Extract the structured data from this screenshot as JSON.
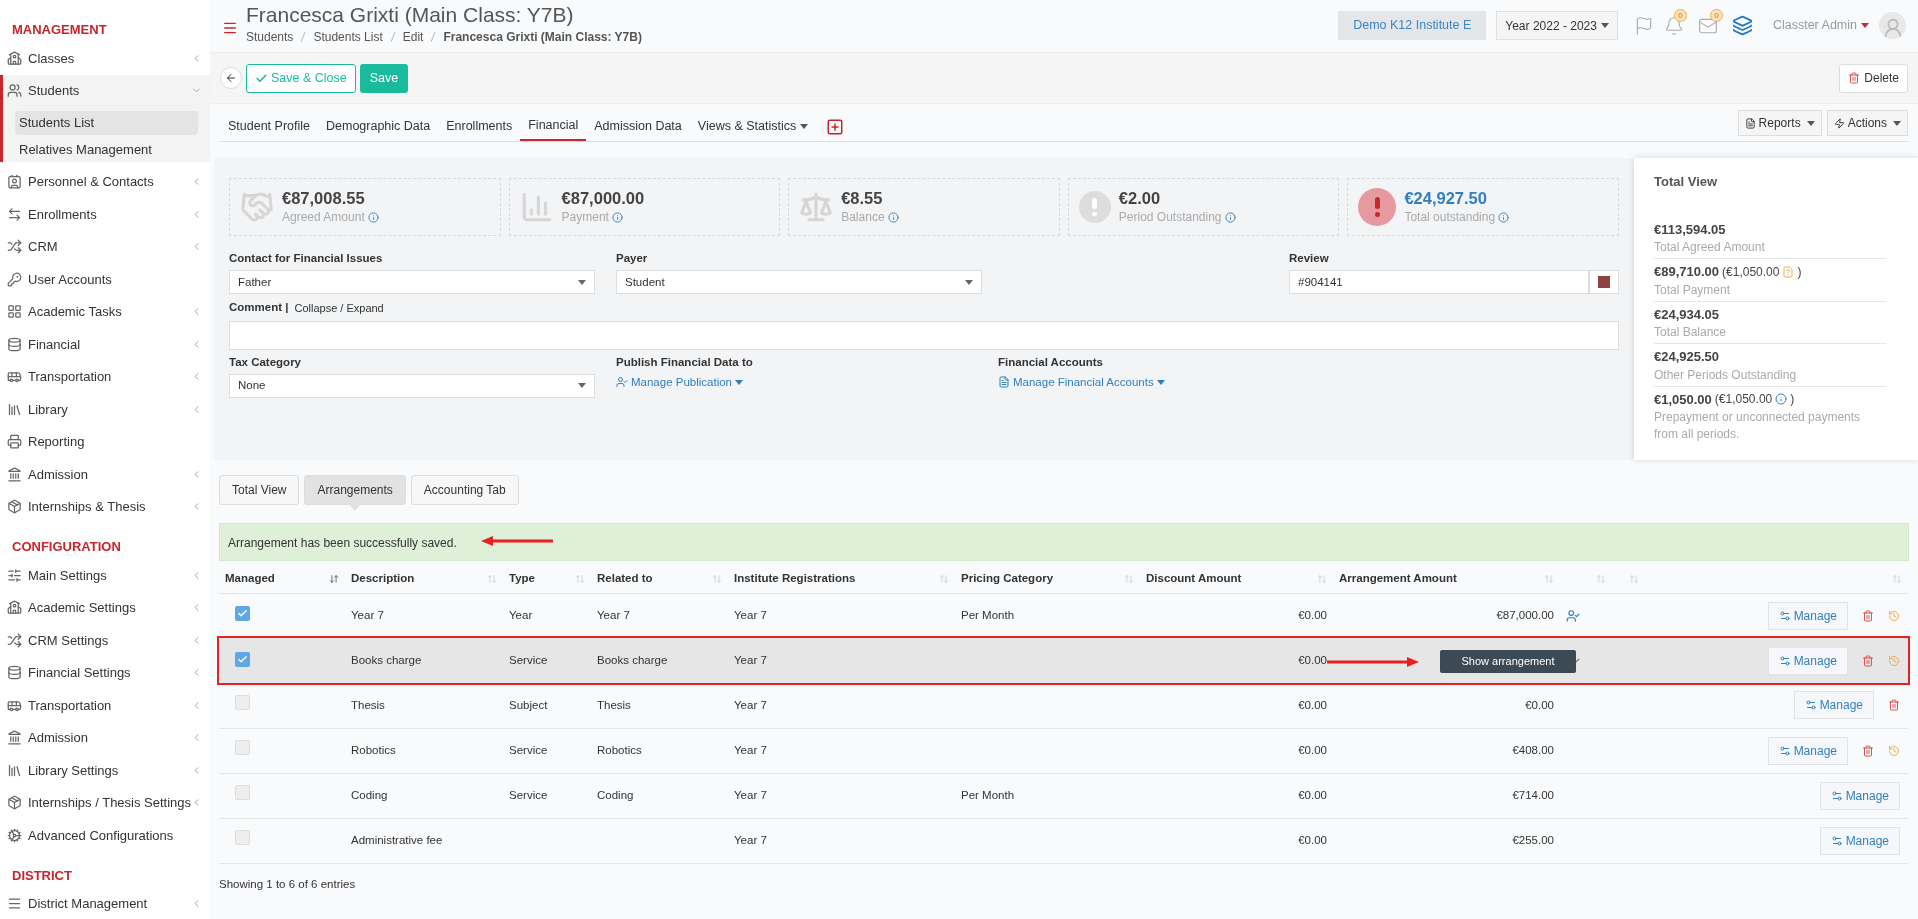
{
  "sidebar": {
    "sections": [
      {
        "title": "MANAGEMENT",
        "items": [
          {
            "label": "Classes",
            "submenu": true,
            "expanded": false,
            "selected": false
          },
          {
            "label": "Students",
            "submenu": true,
            "expanded": true,
            "selected": false,
            "children": [
              {
                "label": "Students List",
                "selected": true
              },
              {
                "label": "Relatives Management",
                "selected": false
              }
            ]
          },
          {
            "label": "Personnel & Contacts",
            "submenu": true,
            "expanded": false,
            "selected": false
          },
          {
            "label": "Enrollments",
            "submenu": true,
            "expanded": false,
            "selected": false
          },
          {
            "label": "CRM",
            "submenu": true,
            "expanded": false,
            "selected": false
          },
          {
            "label": "User Accounts",
            "submenu": false,
            "expanded": false,
            "selected": false
          },
          {
            "label": "Academic Tasks",
            "submenu": true,
            "expanded": false,
            "selected": false
          },
          {
            "label": "Financial",
            "submenu": true,
            "expanded": false,
            "selected": false
          },
          {
            "label": "Transportation",
            "submenu": true,
            "expanded": false,
            "selected": false
          },
          {
            "label": "Library",
            "submenu": true,
            "expanded": false,
            "selected": false
          },
          {
            "label": "Reporting",
            "submenu": false,
            "expanded": false,
            "selected": false
          },
          {
            "label": "Admission",
            "submenu": true,
            "expanded": false,
            "selected": false
          },
          {
            "label": "Internships & Thesis",
            "submenu": true,
            "expanded": false,
            "selected": false
          }
        ]
      },
      {
        "title": "CONFIGURATION",
        "items": [
          {
            "label": "Main Settings",
            "submenu": true,
            "expanded": false,
            "selected": false
          },
          {
            "label": "Academic Settings",
            "submenu": true,
            "expanded": false,
            "selected": false
          },
          {
            "label": "CRM Settings",
            "submenu": true,
            "expanded": false,
            "selected": false
          },
          {
            "label": "Financial Settings",
            "submenu": true,
            "expanded": false,
            "selected": false
          },
          {
            "label": "Transportation",
            "submenu": true,
            "expanded": false,
            "selected": false
          },
          {
            "label": "Admission",
            "submenu": true,
            "expanded": false,
            "selected": false
          },
          {
            "label": "Library Settings",
            "submenu": true,
            "expanded": false,
            "selected": false
          },
          {
            "label": "Internships / Thesis Settings",
            "submenu": true,
            "expanded": false,
            "selected": false
          },
          {
            "label": "Advanced Configurations",
            "submenu": false,
            "expanded": false,
            "selected": false
          }
        ]
      },
      {
        "title": "DISTRICT",
        "items": [
          {
            "label": "District Management",
            "submenu": true,
            "expanded": false,
            "selected": false
          }
        ]
      }
    ]
  },
  "header": {
    "title": "Francesca Grixti (Main Class: Y7B)",
    "breadcrumb": [
      "Students",
      "Students List",
      "Edit",
      "Francesca Grixti (Main Class: Y7B)"
    ],
    "institute": "Demo K12 Institute E",
    "year": "Year 2022 - 2023",
    "notifications": "0",
    "messages": "0",
    "user": "Classter Admin"
  },
  "toolbar": {
    "save_close": "Save & Close",
    "save": "Save",
    "delete": "Delete"
  },
  "tabs": [
    {
      "label": "Student Profile",
      "selected": false,
      "dropdown": false
    },
    {
      "label": "Demographic Data",
      "selected": false,
      "dropdown": false
    },
    {
      "label": "Enrollments",
      "selected": false,
      "dropdown": false
    },
    {
      "label": "Financial",
      "selected": true,
      "dropdown": false
    },
    {
      "label": "Admission Data",
      "selected": false,
      "dropdown": false
    },
    {
      "label": "Views & Statistics",
      "selected": false,
      "dropdown": true
    }
  ],
  "tab_buttons": [
    "Reports",
    "Actions"
  ],
  "stats": [
    {
      "value": "€87,008.55",
      "label": "Agreed Amount",
      "alert": false
    },
    {
      "value": "€87,000.00",
      "label": "Payment",
      "alert": false
    },
    {
      "value": "€8.55",
      "label": "Balance",
      "alert": false
    },
    {
      "value": "€2.00",
      "label": "Period Outstanding",
      "alert": false
    },
    {
      "value": "€24,927.50",
      "label": "Total outstanding",
      "alert": true
    }
  ],
  "form": {
    "contact": {
      "label": "Contact for Financial Issues",
      "value": "Father"
    },
    "payer": {
      "label": "Payer",
      "value": "Student"
    },
    "review": {
      "label": "Review",
      "value": "#904141",
      "color": "#904141"
    },
    "comment": {
      "label": "Comment |",
      "toggle": "Collapse / Expand"
    },
    "tax": {
      "label": "Tax Category",
      "value": "None"
    },
    "publish": {
      "label": "Publish Financial Data to",
      "link": "Manage Publication"
    },
    "accounts": {
      "label": "Financial Accounts",
      "link": "Manage Financial Accounts"
    }
  },
  "total_view": {
    "title": "Total View",
    "items": [
      {
        "kind": "plain",
        "value": "€113,594.05",
        "label": "Total Agreed Amount"
      },
      {
        "kind": "file",
        "value": "€89,710.00",
        "extra": "(€1,050.00",
        "extra_end": ")",
        "label": "Total Payment"
      },
      {
        "kind": "plain",
        "value": "€24,934.05",
        "label": "Total Balance"
      },
      {
        "kind": "plain",
        "value": "€24,925.50",
        "label": "Other Periods Outstanding"
      },
      {
        "kind": "info",
        "value": "€1,050.00",
        "extra": "(€1,050.00",
        "extra_end": ")",
        "label": "Prepayment or unconnected payments from all periods."
      }
    ]
  },
  "sub_tabs": [
    {
      "label": "Total View",
      "selected": false
    },
    {
      "label": "Arrangements",
      "selected": true
    },
    {
      "label": "Accounting Tab",
      "selected": false
    }
  ],
  "alert": "Arrangement has been successfully saved.",
  "table": {
    "columns": [
      {
        "label": "Managed",
        "sorted": true
      },
      {
        "label": "Description",
        "sorted": false
      },
      {
        "label": "Type",
        "sorted": false
      },
      {
        "label": "Related to",
        "sorted": false
      },
      {
        "label": "Institute Registrations",
        "sorted": false
      },
      {
        "label": "Pricing Category",
        "sorted": false
      },
      {
        "label": "Discount Amount",
        "sorted": false
      },
      {
        "label": "Arrangement Amount",
        "sorted": false
      },
      {
        "sorted": false
      },
      {
        "sorted": false
      },
      {
        "sorted": false
      }
    ],
    "rows": [
      {
        "manage": "Manage",
        "checked": true,
        "description": "Year 7",
        "type": "Year",
        "related": "Year 7",
        "registration": "Year 7",
        "pricing": "Per Month",
        "discount": "€0.00",
        "amount": "€87,000.00",
        "user_icon": {
          "active": true
        },
        "deletable": true,
        "restorable": true,
        "highlighted": false
      },
      {
        "manage": "Manage",
        "checked": true,
        "description": "Books charge",
        "type": "Service",
        "related": "Books charge",
        "registration": "Year 7",
        "discount": "€0.00",
        "tooltip": "Show arrangement",
        "user_icon": {
          "active": false
        },
        "deletable": true,
        "restorable": true,
        "highlighted": true
      },
      {
        "manage": "Manage",
        "checked": false,
        "description": "Thesis",
        "type": "Subject",
        "related": "Thesis",
        "registration": "Year 7",
        "discount": "€0.00",
        "amount": "€0.00",
        "deletable": true,
        "restorable": false,
        "highlighted": false
      },
      {
        "manage": "Manage",
        "checked": false,
        "description": "Robotics",
        "type": "Service",
        "related": "Robotics",
        "registration": "Year 7",
        "discount": "€0.00",
        "amount": "€408.00",
        "deletable": true,
        "restorable": true,
        "highlighted": false
      },
      {
        "manage": "Manage",
        "checked": false,
        "description": "Coding",
        "type": "Service",
        "related": "Coding",
        "registration": "Year 7",
        "pricing": "Per Month",
        "discount": "€0.00",
        "amount": "€714.00",
        "deletable": false,
        "restorable": false,
        "highlighted": false
      },
      {
        "manage": "Manage",
        "checked": false,
        "description": "Administrative fee",
        "registration": "Year 7",
        "discount": "€0.00",
        "amount": "€255.00",
        "deletable": false,
        "restorable": false,
        "highlighted": false
      }
    ],
    "footer": "Showing 1 to 6 of 6 entries"
  }
}
